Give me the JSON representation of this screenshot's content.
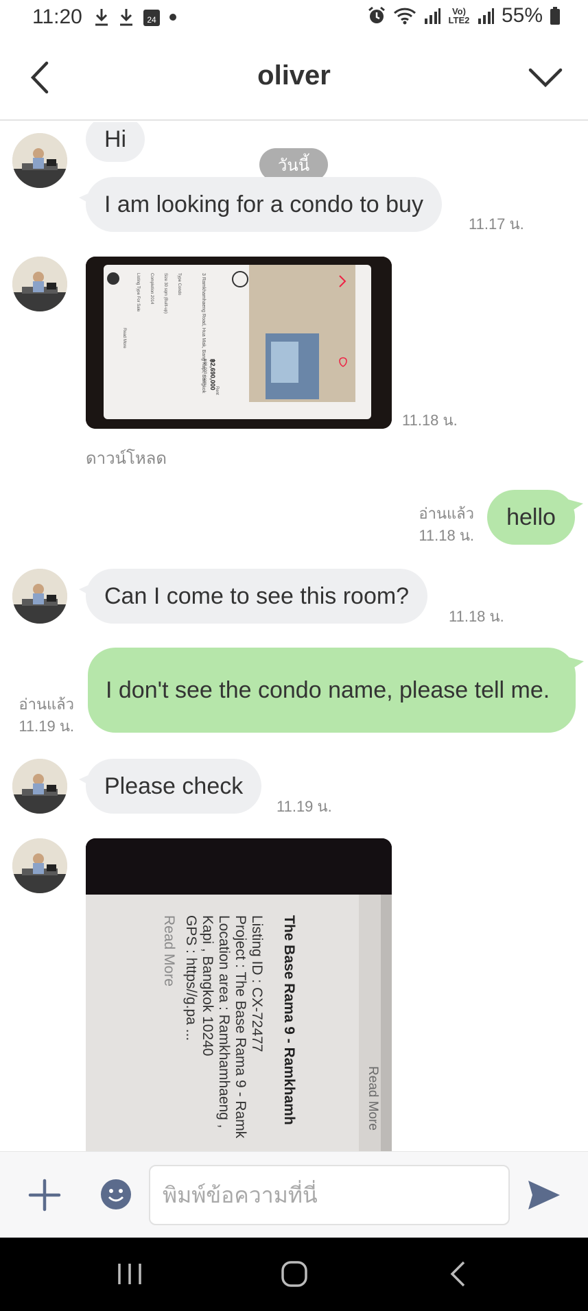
{
  "status_bar": {
    "time": "11:20",
    "calendar_day": "24",
    "network_label": "Vo) LTE2",
    "battery_percent": "55%",
    "left_icons": [
      "download-icon",
      "download-icon",
      "calendar-icon",
      "dot-icon"
    ],
    "right_icons": [
      "alarm-icon",
      "wifi-icon",
      "signal-icon",
      "volte-icon",
      "signal-icon",
      "battery-icon"
    ]
  },
  "header": {
    "title": "oliver",
    "back_icon": "chevron-left-icon",
    "menu_icon": "chevron-down-icon"
  },
  "chat": {
    "date_chip": "วันนี้",
    "messages": [
      {
        "side": "in",
        "type": "text",
        "text": "Hi",
        "time": ""
      },
      {
        "side": "in",
        "type": "text",
        "text": "I am looking for a condo to buy",
        "time": "11.17 น."
      },
      {
        "side": "in",
        "type": "image",
        "time": "11.18 น.",
        "download_label": "ดาวน์โหลด"
      },
      {
        "side": "out",
        "type": "text",
        "text": "hello",
        "read": "อ่านแล้ว",
        "time": "11.18 น."
      },
      {
        "side": "in",
        "type": "text",
        "text": "Can I come to see this room?",
        "time": "11.18 น."
      },
      {
        "side": "out",
        "type": "text",
        "text": "I don't see the condo name, please tell me.",
        "read": "อ่านแล้ว",
        "time": "11.19 น."
      },
      {
        "side": "in",
        "type": "text",
        "text": "Please check",
        "time": "11.19 น."
      },
      {
        "side": "in",
        "type": "image",
        "time": ""
      }
    ],
    "photo1_text": {
      "address": "3 Ramkhamhaeng Road, Hua Mak, Bang Kapi, Bangkok",
      "price": "฿2,690,000",
      "price_sub": "฿88,000 / sqm",
      "rent_label": "Rent",
      "rows": [
        "Type  Condo",
        "Size  30 sqm (Built-up)",
        "Completion  2014",
        "Listing Type  For Sale"
      ],
      "read_more": "Read More"
    },
    "photo2_text": {
      "title": "The Base Rama 9 - Ramkhamh",
      "listing_id": "Listing ID : CX-72477",
      "project": "Project : The Base Rama 9 - Ramk",
      "location": "Location area : Ramkhamhaeng ,",
      "district": "Kapi , Bangkok 10240",
      "gps": "GPS : https//g.pa ...",
      "read_more": "Read More",
      "read_more_side": "Read More"
    }
  },
  "input_bar": {
    "placeholder": "พิมพ์ข้อความที่นี่",
    "plus_icon": "plus-icon",
    "emoji_icon": "smiley-icon",
    "send_icon": "send-icon"
  },
  "nav_bar": {
    "icons": [
      "recent-apps-icon",
      "home-icon",
      "back-icon"
    ]
  },
  "colors": {
    "incoming_bubble": "#eeeff1",
    "outgoing_bubble": "#b6e6aa",
    "accent_icon": "#5b6b8c"
  }
}
